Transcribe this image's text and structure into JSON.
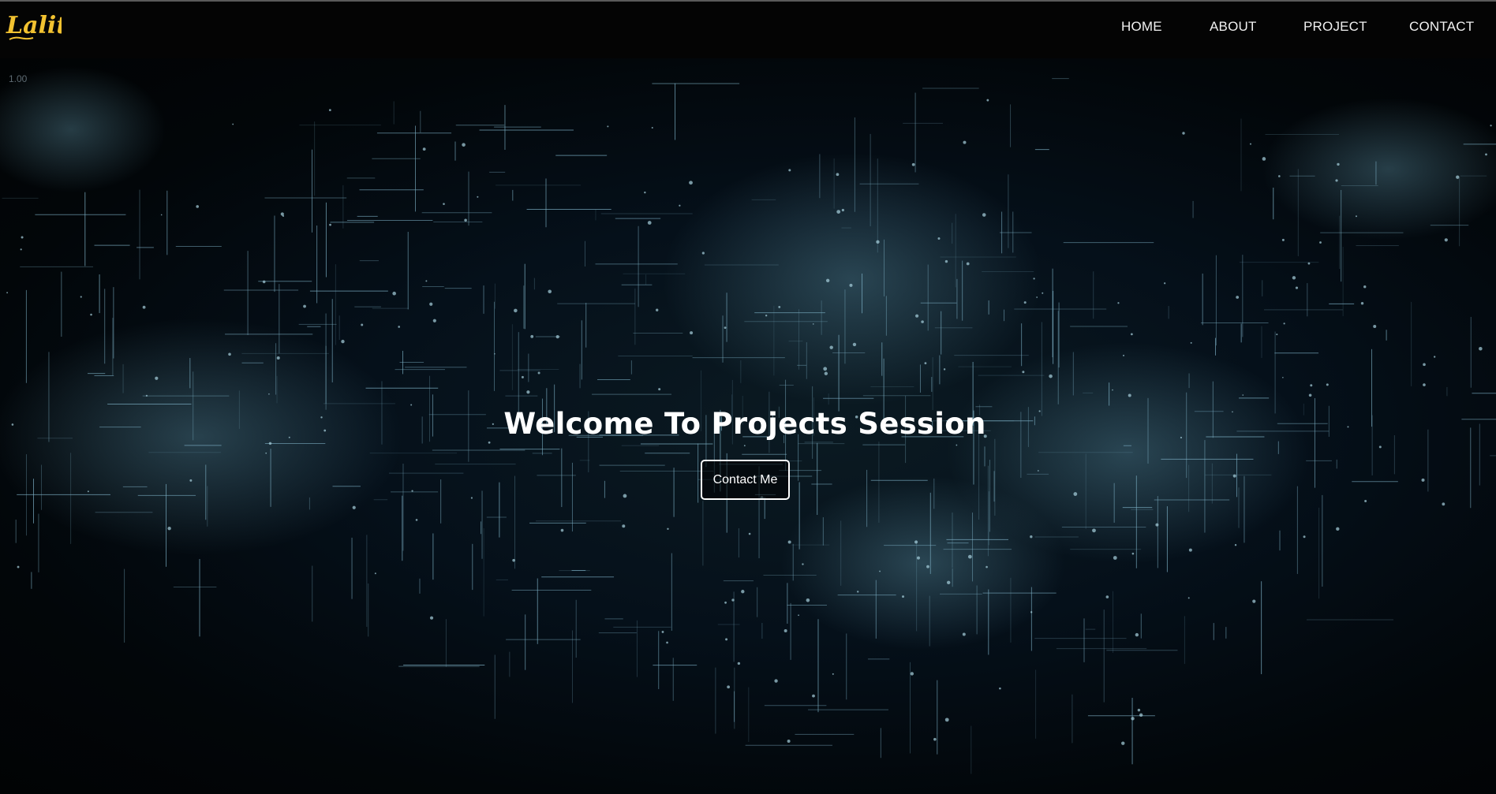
{
  "brand": {
    "logo_text": "Lalit",
    "logo_color": "#f2c230"
  },
  "nav": {
    "items": [
      {
        "label": "HOME"
      },
      {
        "label": "ABOUT"
      },
      {
        "label": "PROJECT"
      },
      {
        "label": "CONTACT"
      }
    ]
  },
  "hero": {
    "version": "1.00",
    "title": "Welcome To Projects Session",
    "cta_label": "Contact Me"
  },
  "colors": {
    "nav_bg": "#040404",
    "hero_line": "#7fb3c8",
    "text": "#ffffff"
  }
}
